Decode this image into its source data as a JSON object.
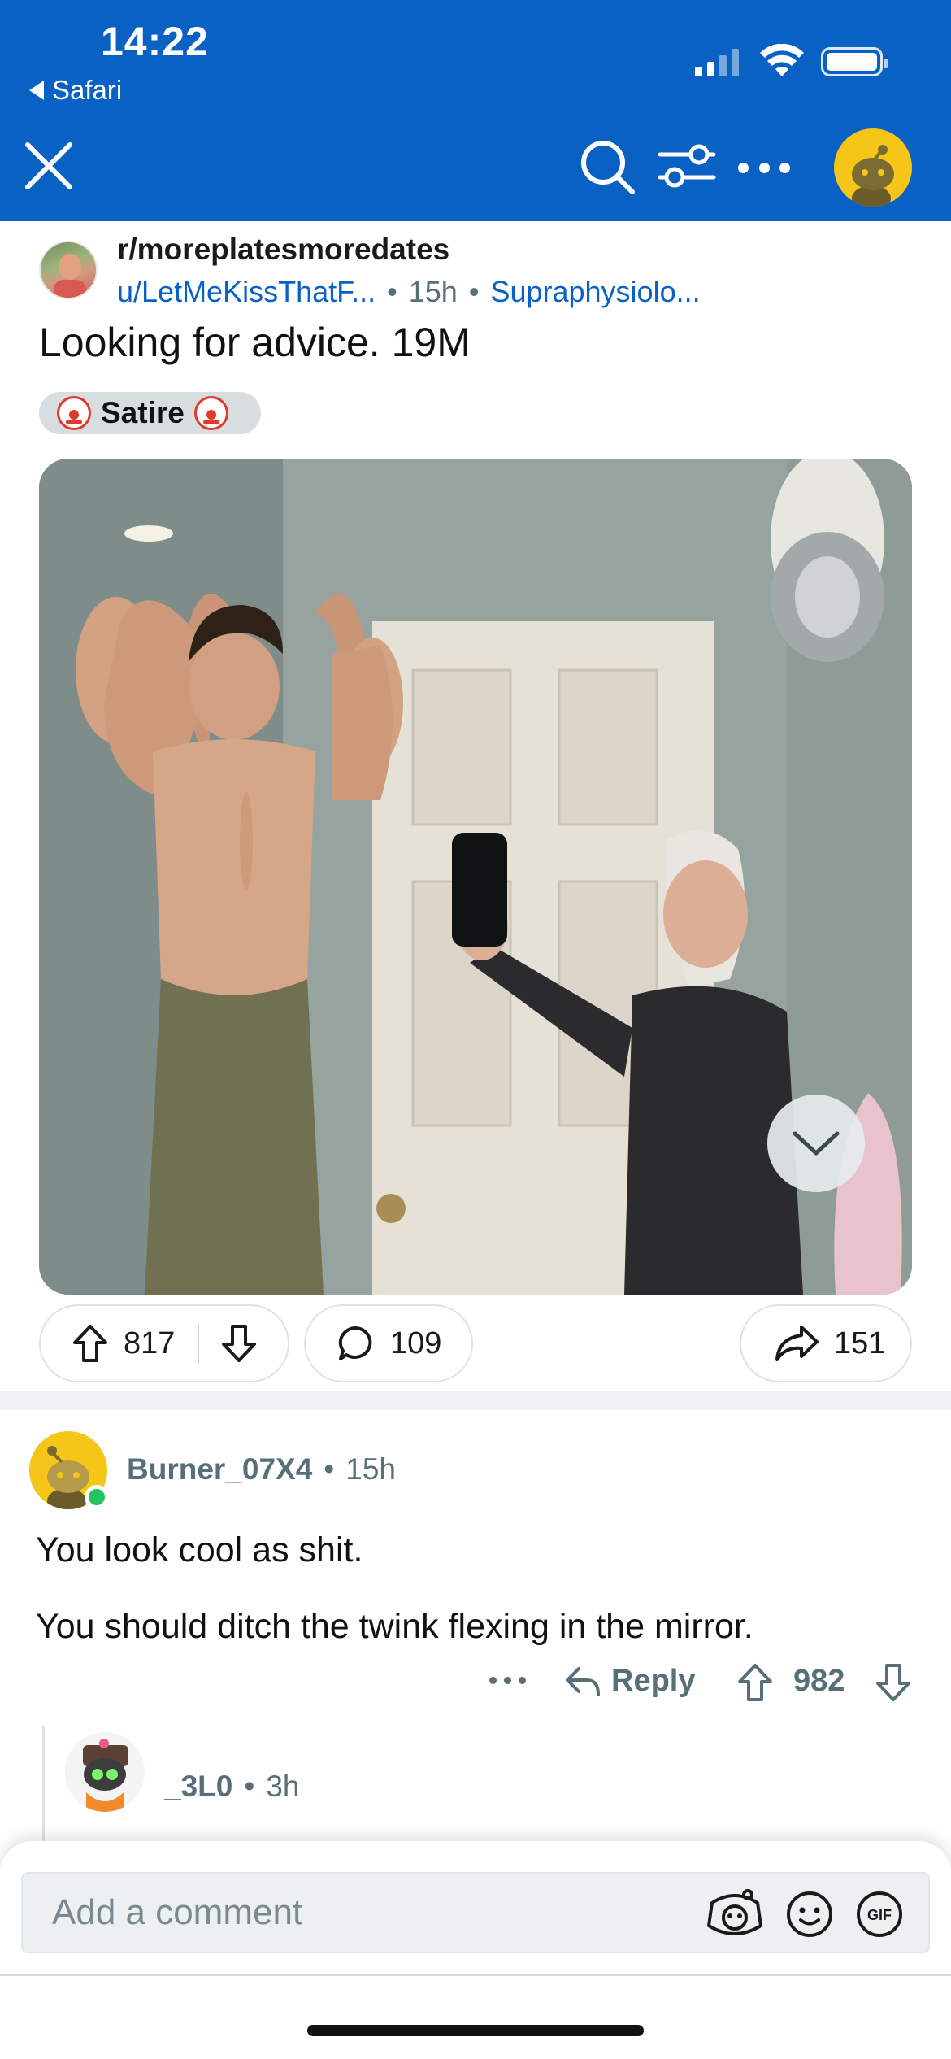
{
  "status_bar": {
    "time": "14:22",
    "back_app": "Safari"
  },
  "header": {
    "icons": [
      "close-icon",
      "search-icon",
      "filter-icon",
      "more-icon",
      "user-avatar"
    ],
    "accent_color": "#0a61c4"
  },
  "post": {
    "subreddit": "r/moreplatesmoredates",
    "author": "u/LetMeKissThatF...",
    "age": "15h",
    "sep": "•",
    "user_flair": "Supraphysiolo...",
    "title": "Looking for advice. 19M",
    "flair": "Satire",
    "image_alt": "mirror selfie",
    "upvotes": "817",
    "comments": "109",
    "shares": "151"
  },
  "comments": [
    {
      "author": "Burner_07X4",
      "age": "15h",
      "lines": [
        "You look cool as shit.",
        "You should ditch the twink flexing in the mirror."
      ],
      "reply_label": "Reply",
      "score": "982"
    },
    {
      "author": "_3L0",
      "age": "3h"
    }
  ],
  "composer": {
    "placeholder": "Add a comment",
    "gif_label": "GIF"
  }
}
